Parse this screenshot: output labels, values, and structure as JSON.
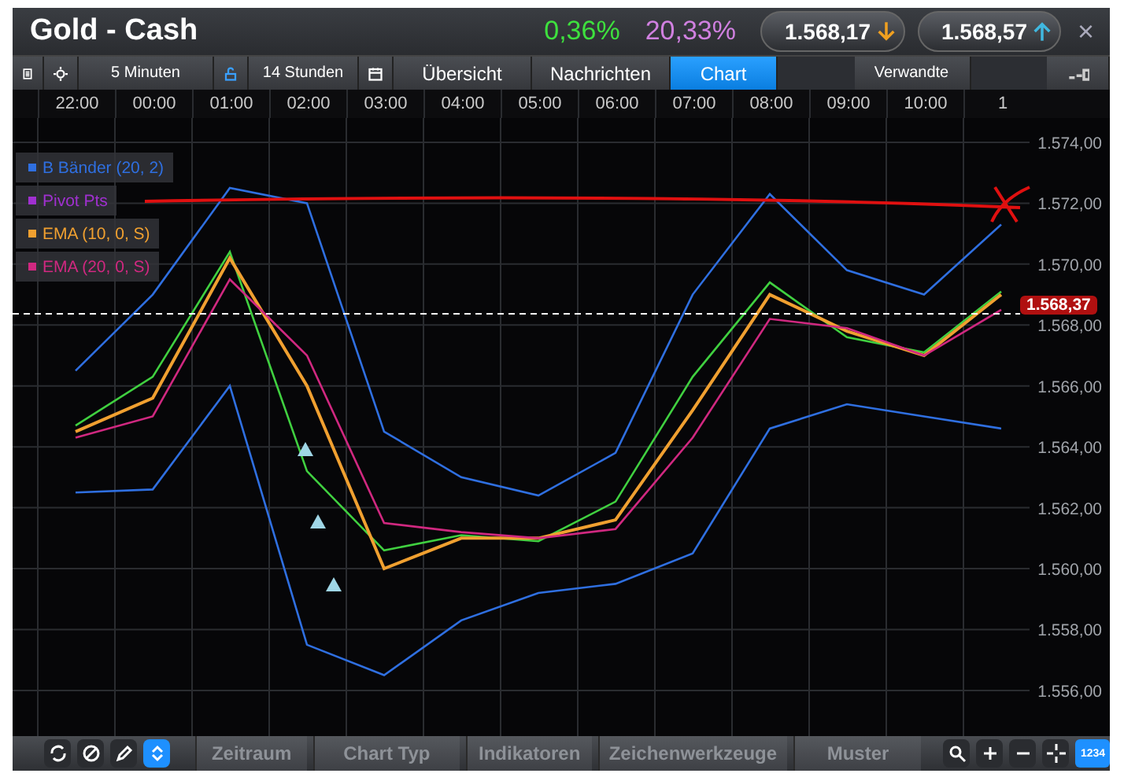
{
  "window": {
    "title": "Gold - Cash",
    "change": "0,36%",
    "volatility": "20,33%",
    "bid": "1.568,17",
    "ask": "1.568,57",
    "close": "×"
  },
  "toolbar": {
    "interval": "5 Minuten",
    "range": "14 Stunden"
  },
  "tabs": [
    {
      "label": "Übersicht",
      "selected": false
    },
    {
      "label": "Nachrichten",
      "selected": false
    },
    {
      "label": "Chart",
      "selected": true
    }
  ],
  "related": "Verwandte",
  "legend": [
    {
      "label": "B Bänder (20, 2)",
      "color": "#2f6fe0"
    },
    {
      "label": "Pivot Pts",
      "color": "#a030d0"
    },
    {
      "label": "EMA (10, 0, S)",
      "color": "#f0a030"
    },
    {
      "label": "EMA (20, 0, S)",
      "color": "#d02880"
    }
  ],
  "chart_data": {
    "type": "line",
    "grid": true,
    "ref_lines": [
      {
        "axis": "y",
        "value": 1568.37,
        "label": "1.568,37"
      }
    ],
    "categories": [
      "22:00",
      "00:00",
      "01:00",
      "02:00",
      "03:00",
      "04:00",
      "05:00",
      "06:00",
      "07:00",
      "08:00",
      "09:00",
      "10:00",
      "1"
    ],
    "ylim": [
      1554.5,
      1574.8
    ],
    "yticks": [
      {
        "value": 1556,
        "label": "1.556,00"
      },
      {
        "value": 1558,
        "label": "1.558,00"
      },
      {
        "value": 1560,
        "label": "1.560,00"
      },
      {
        "value": 1562,
        "label": "1.562,00"
      },
      {
        "value": 1564,
        "label": "1.564,00"
      },
      {
        "value": 1566,
        "label": "1.566,00"
      },
      {
        "value": 1568,
        "label": "1.568,00"
      },
      {
        "value": 1570,
        "label": "1.570,00"
      },
      {
        "value": 1572,
        "label": "1.572,00"
      },
      {
        "value": 1574,
        "label": "1.574,00"
      }
    ],
    "series": [
      {
        "color": "#40d040",
        "values": [
          1564.7,
          1566.3,
          1570.4,
          1563.2,
          1560.6,
          1561.1,
          1560.9,
          1562.2,
          1566.3,
          1569.4,
          1567.6,
          1567.1,
          1569.1
        ]
      },
      {
        "color": "#f0a030",
        "values": [
          1564.5,
          1565.6,
          1570.2,
          1566.0,
          1560.0,
          1561.0,
          1561.0,
          1561.6,
          1565.2,
          1569.0,
          1567.8,
          1567.0,
          1569.0
        ]
      },
      {
        "color": "#d02880",
        "values": [
          1564.3,
          1565.0,
          1569.5,
          1567.0,
          1561.5,
          1561.2,
          1561.0,
          1561.3,
          1564.3,
          1568.2,
          1567.9,
          1567.0,
          1568.5
        ]
      },
      {
        "color": "#2f6fe0",
        "values": [
          1566.5,
          1569.0,
          1572.5,
          1572.0,
          1564.5,
          1563.0,
          1562.4,
          1563.8,
          1569.0,
          1572.3,
          1569.8,
          1569.0,
          1571.3
        ]
      },
      {
        "color": "#2f6fe0",
        "values": [
          1562.5,
          1562.6,
          1566.0,
          1557.5,
          1556.5,
          1558.3,
          1559.2,
          1559.5,
          1560.5,
          1564.6,
          1565.4,
          1565.0,
          1564.6
        ]
      }
    ]
  },
  "bottom_bar": {
    "buttons": [
      "Zeitraum",
      "Chart Typ",
      "Indikatoren",
      "Zeichenwerkzeuge",
      "Muster"
    ],
    "numbers": "1234"
  }
}
